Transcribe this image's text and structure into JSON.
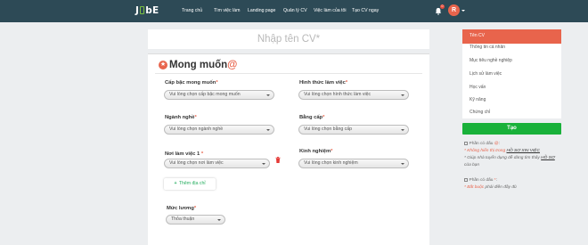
{
  "nav": {
    "logo": "JOBE",
    "items": [
      "Trang chủ",
      "Tìm việc làm",
      "Landing page",
      "Quản lý CV",
      "Việc làm của tôi",
      "Tạo CV ngay"
    ],
    "notification_count": "0",
    "avatar_letter": "R"
  },
  "cv_title": {
    "placeholder": "Nhập tên CV*"
  },
  "section": {
    "title": "Mong muốn",
    "title_suffix": "@"
  },
  "fields": {
    "level": {
      "label": "Cấp bậc mong muốn",
      "value": "Vui lòng chọn cấp bậc mong muốn"
    },
    "work_form": {
      "label": "Hình thức làm việc",
      "value": "Vui lòng chọn hình thức làm việc"
    },
    "industry": {
      "label": "Ngành nghề",
      "value": "Vui lòng chọn ngành nghề"
    },
    "degree": {
      "label": "Bằng cấp",
      "value": "Vui lòng chọn bằng cấp"
    },
    "location": {
      "label": "Nơi làm việc 1",
      "value": "Vui lòng chọn nơi làm việc"
    },
    "experience": {
      "label": "Kinh nghiệm",
      "value": "Vui lòng chọn kinh nghiệm"
    },
    "salary": {
      "label": "Mức lương",
      "value": "Thỏa thuận"
    },
    "required_mark": "*",
    "add_location": "Thêm địa chỉ"
  },
  "sidebar": {
    "menu": [
      "Tên CV",
      "Thông tin cá nhân",
      "Mục tiêu nghề nghiệp",
      "Lịch sử làm việc",
      "Học vấn",
      "Kỹ năng",
      "Chứng chỉ"
    ],
    "save_label": "Tạo",
    "hint1": {
      "line1_prefix": "Phần có dấu",
      "line1_mark": "@",
      "line1_suffix": ":",
      "line2_prefix": "* Không hiển thị trong",
      "line2_link": "HỒ SƠ XIN VIỆC",
      "line3_prefix": "* Giúp nhà tuyển dụng dễ dàng tìm thấy",
      "line3_link": "HỒ SƠ",
      "line4": "của bạn"
    },
    "hint2": {
      "line1_prefix": "Phần có dấu",
      "line1_mark": "*",
      "line1_suffix": ":",
      "line2_mark": "* Bắt buộc",
      "line2_suffix": "phải điền đầy đủ"
    }
  },
  "colors": {
    "nav_bg": "#2d4a56",
    "accent": "#e8644c",
    "save_green": "#19b13a",
    "logo_green": "#7dc242"
  }
}
